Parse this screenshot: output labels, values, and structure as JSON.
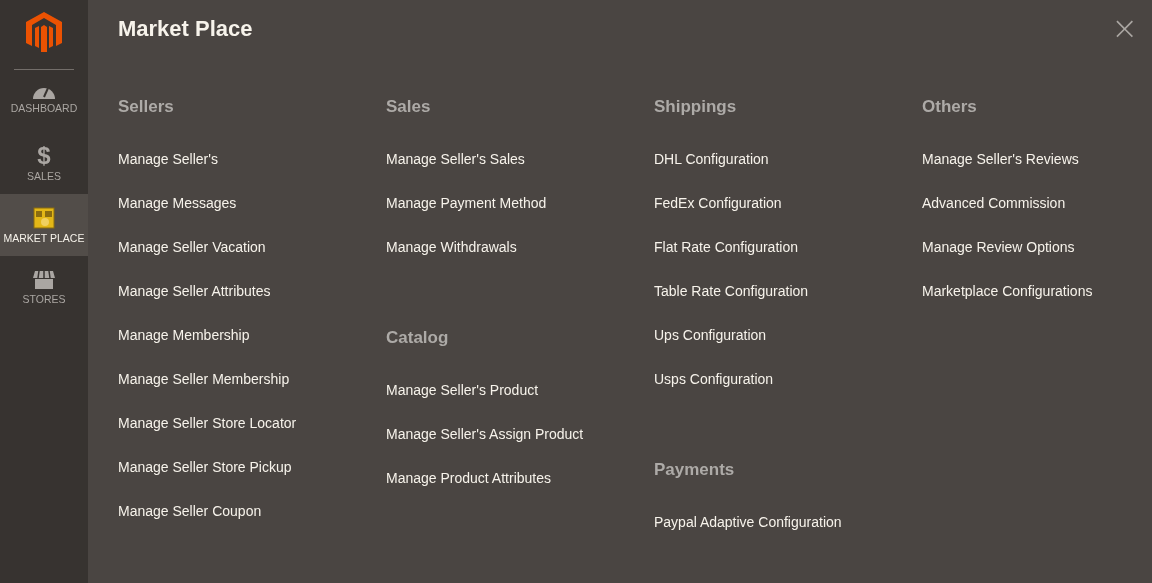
{
  "sidebar": {
    "items": [
      {
        "label": "DASHBOARD",
        "kind": "gauge",
        "selected": false
      },
      {
        "label": "SALES",
        "kind": "glyph",
        "glyph": "$",
        "selected": false
      },
      {
        "label": "MARKET PLACE",
        "kind": "market",
        "selected": true
      },
      {
        "label": "STORES",
        "kind": "store",
        "selected": false
      }
    ]
  },
  "panel": {
    "title": "Market Place",
    "close": "×",
    "columns": [
      {
        "groups": [
          {
            "title": "Sellers",
            "items": [
              "Manage Seller's",
              "Manage Messages",
              "Manage Seller Vacation",
              "Manage Seller Attributes",
              "Manage Membership",
              "Manage Seller Membership",
              "Manage Seller Store Locator",
              "Manage Seller Store Pickup",
              "Manage Seller Coupon"
            ]
          }
        ]
      },
      {
        "groups": [
          {
            "title": "Sales",
            "items": [
              "Manage Seller's Sales",
              "Manage Payment Method",
              "Manage Withdrawals"
            ]
          },
          {
            "title": "Catalog",
            "items": [
              "Manage Seller's Product",
              "Manage Seller's Assign Product",
              "Manage Product Attributes"
            ]
          }
        ]
      },
      {
        "groups": [
          {
            "title": "Shippings",
            "items": [
              "DHL Configuration",
              "FedEx Configuration",
              "Flat Rate Configuration",
              "Table Rate Configuration",
              "Ups Configuration",
              "Usps Configuration"
            ]
          },
          {
            "title": "Payments",
            "items": [
              "Paypal Adaptive Configuration"
            ]
          }
        ]
      },
      {
        "groups": [
          {
            "title": "Others",
            "items": [
              "Manage Seller's Reviews",
              "Advanced Commission",
              "Manage Review Options",
              "Marketplace Configurations"
            ]
          }
        ]
      }
    ]
  }
}
